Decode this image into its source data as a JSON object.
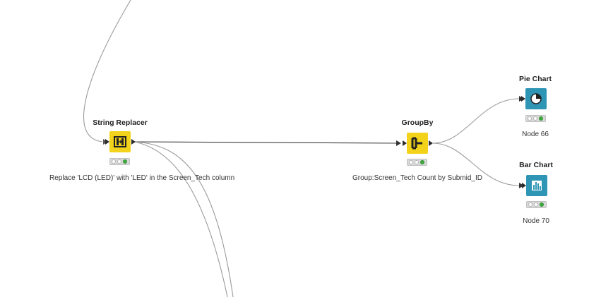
{
  "workflow": {
    "nodes": {
      "string_replacer": {
        "title": "String Replacer",
        "description": "Replace 'LCD (LED)' with 'LED' in the Screen_Tech column",
        "icon": "string-replacer-icon",
        "color": "#f2d21a",
        "status": [
          "idle",
          "idle",
          "executed"
        ]
      },
      "groupby": {
        "title": "GroupBy",
        "description": "Group:Screen_Tech Count by Submid_ID",
        "icon": "groupby-icon",
        "color": "#f2d21a",
        "status": [
          "idle",
          "idle",
          "executed"
        ]
      },
      "pie_chart": {
        "title": "Pie Chart",
        "description": "Node 66",
        "icon": "pie-chart-icon",
        "color": "#2f95b5",
        "status": [
          "idle",
          "idle",
          "executed"
        ]
      },
      "bar_chart": {
        "title": "Bar Chart",
        "description": "Node 70",
        "icon": "bar-chart-icon",
        "color": "#2f95b5",
        "status": [
          "idle",
          "idle",
          "executed"
        ]
      }
    },
    "colors": {
      "connection": "#9a9a9a",
      "connection_active": "#3d3d3d",
      "status_executed": "#3fae3f"
    }
  }
}
